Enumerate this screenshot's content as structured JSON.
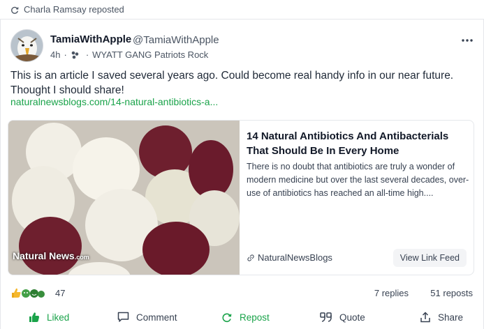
{
  "repost_banner": {
    "text": "Charla Ramsay reposted",
    "icon": "repost-icon"
  },
  "post": {
    "author_name": "TamiaWithApple",
    "author_handle": "@TamiaWithApple",
    "time": "4h",
    "dot": "·",
    "group": "WYATT GANG Patriots Rock",
    "text": "This is an article I saved several years ago. Could become real handy info in our near future. Thought I should share!",
    "link": "naturalnewsblogs.com/14-natural-antibiotics-a..."
  },
  "link_preview": {
    "image_caption": "Natural News",
    "image_caption_suffix": ".com",
    "title": "14 Natural Antibiotics And Antibacterials That Should Be In Every Home",
    "description": "There is no doubt that antibiotics are truly a wonder of modern medicine but over the last several decades, over-use of antibiotics has reached an all-time high....",
    "source": "NaturalNewsBlogs",
    "view_button": "View Link Feed"
  },
  "stats": {
    "reactions_count": "47",
    "replies": "7 replies",
    "reposts": "51 reposts"
  },
  "actions": {
    "liked": "Liked",
    "comment": "Comment",
    "repost": "Repost",
    "quote": "Quote",
    "share": "Share"
  },
  "colors": {
    "accent": "#1aa34a",
    "text": "#1f2937",
    "muted": "#4b5563",
    "border": "#e5e7eb"
  }
}
